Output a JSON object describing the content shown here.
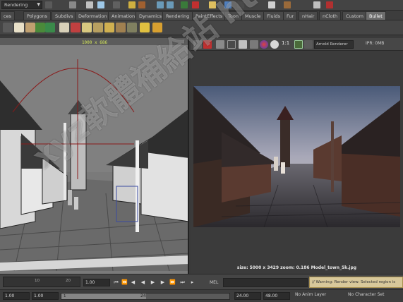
{
  "status_line": {
    "mode": "Rendering"
  },
  "shelf_tabs": [
    {
      "label": "ces"
    },
    {
      "label": "Polygons"
    },
    {
      "label": "Subdivs"
    },
    {
      "label": "Deformation"
    },
    {
      "label": "Animation"
    },
    {
      "label": "Dynamics"
    },
    {
      "label": "Rendering"
    },
    {
      "label": "PaintEffects"
    },
    {
      "label": "Toon"
    },
    {
      "label": "Muscle"
    },
    {
      "label": "Fluids"
    },
    {
      "label": "Fur"
    },
    {
      "label": "nHair"
    },
    {
      "label": "nCloth"
    },
    {
      "label": "Custom"
    },
    {
      "label": "Bullet",
      "active": true
    }
  ],
  "viewport": {
    "resolution_gate": "1000 x 686"
  },
  "render_view": {
    "ratio": "1:1",
    "renderer": "Arnold Renderer",
    "ipr_mem": "IPR: 0MB",
    "caption": "size: 5000 x 3429 zoom: 0.186 Model_town_5k.jpg"
  },
  "time_slider": {
    "ticks": [
      "1",
      "10",
      "20"
    ],
    "current_frame": "1.00",
    "mel_label": "MEL",
    "warning": "// Warning: Render view: Selected region is"
  },
  "range_slider": {
    "start_time": "1.00",
    "playback_start": "1.00",
    "range_start": "1",
    "range_end": "24",
    "playback_end": "24.00",
    "end_time": "48.00",
    "anim_layer": "No Anim Layer",
    "character_set": "No Character Set"
  },
  "watermark": {
    "text": "xyz軟體補給站 http://31.to"
  }
}
